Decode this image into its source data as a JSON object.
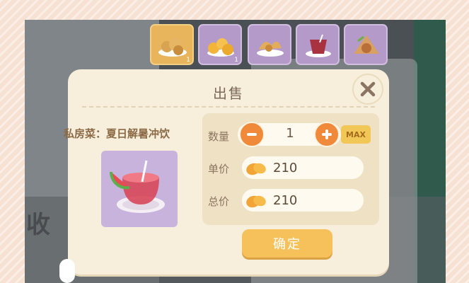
{
  "background": {
    "side_text": "收"
  },
  "inventory": {
    "slots": [
      {
        "icon": "fried-dumplings-icon",
        "count": "1"
      },
      {
        "icon": "golden-buns-icon",
        "count": "1"
      },
      {
        "icon": "fried-shrimp-icon",
        "count": ""
      },
      {
        "icon": "fruit-punch-icon",
        "count": ""
      },
      {
        "icon": "roasted-fish-icon",
        "count": ""
      }
    ]
  },
  "dialog": {
    "title": "出售",
    "item_name": "私房菜：夏日解暑冲饮",
    "item_icon": "watermelon-drink-icon",
    "quantity_label": "数量",
    "quantity_value": "1",
    "max_label": "MAX",
    "unit_price_label": "单价",
    "unit_price_value": "210",
    "total_price_label": "总价",
    "total_price_value": "210",
    "confirm_label": "确定"
  },
  "colors": {
    "accent_orange": "#f08a3a",
    "confirm_yellow": "#f6c15b",
    "dialog_bg": "#f7efdc",
    "item_card": "#c8b3dd"
  }
}
